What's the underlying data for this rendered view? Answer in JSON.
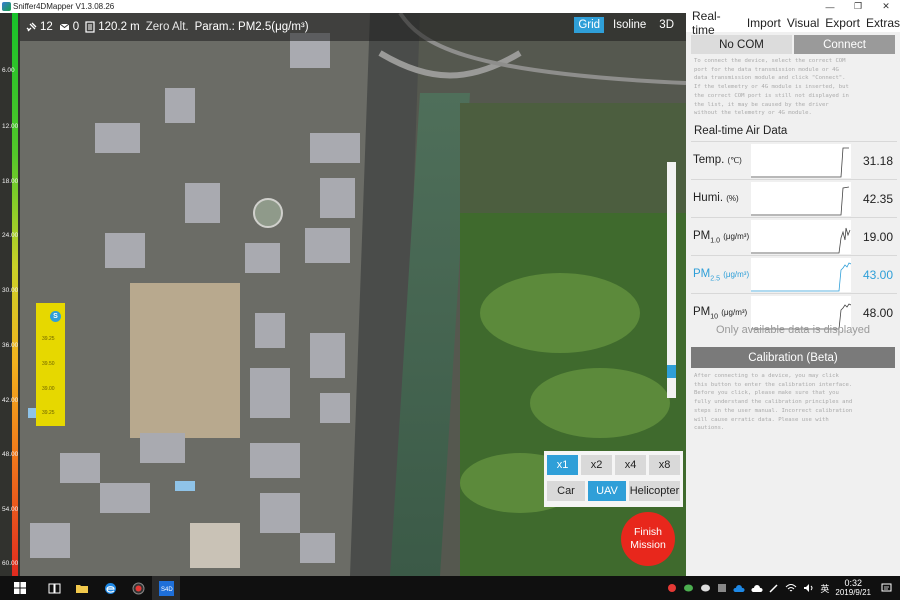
{
  "window": {
    "title": "Sniffer4DMapper V1.3.08.26"
  },
  "infobar": {
    "satellites": "12",
    "messages": "0",
    "altitude": "120.2 m",
    "zero_alt": "Zero Alt.",
    "param": "Param.: PM2.5(μg/m³)",
    "toggles": [
      "Grid",
      "Isoline",
      "3D"
    ],
    "active_toggle": "Grid"
  },
  "scale": {
    "ticks": [
      "6.00",
      "12.00",
      "18.00",
      "24.00",
      "30.00",
      "36.00",
      "42.00",
      "48.00",
      "54.00",
      "60.00"
    ]
  },
  "concentration_strip": {
    "values": [
      "39.25",
      "39.50",
      "39.00",
      "39.25"
    ]
  },
  "scroll": {
    "position_fraction": 0.91
  },
  "speed": {
    "options": [
      "x1",
      "x2",
      "x4",
      "x8"
    ],
    "active": "x1"
  },
  "vehicle": {
    "options": [
      "Car",
      "UAV",
      "Helicopter"
    ],
    "active": "UAV"
  },
  "finish": {
    "line1": "Finish",
    "line2": "Mission"
  },
  "panel": {
    "menu": [
      "Real-time",
      "Import",
      "Visual",
      "Export",
      "Extras"
    ],
    "no_com": "No COM",
    "connect": "Connect",
    "connect_hint": [
      "To connect the device, select the correct COM",
      "port for the data transmission module or 4G",
      "data transmission module and click \"Connect\".",
      "If the telemetry or 4G module is inserted, but",
      "the correct COM port is still not displayed in",
      "the list, it may be caused by the driver",
      "without the telemetry or 4G module."
    ],
    "air_data_title": "Real-time Air Data",
    "air_data": [
      {
        "label": "Temp.",
        "sub": "",
        "unit": "(℃)",
        "value": "31.18",
        "highlight": false
      },
      {
        "label": "Humi.",
        "sub": "",
        "unit": "(%)",
        "value": "42.35",
        "highlight": false
      },
      {
        "label": "PM",
        "sub": "1.0",
        "unit": "(μg/m³)",
        "value": "19.00",
        "highlight": false
      },
      {
        "label": "PM",
        "sub": "2.5",
        "unit": "(μg/m³)",
        "value": "43.00",
        "highlight": true
      },
      {
        "label": "PM",
        "sub": "10",
        "unit": "(μg/m³)",
        "value": "48.00",
        "highlight": false
      }
    ],
    "only_note": "Only available data is displayed",
    "calibration": "Calibration (Beta)",
    "calibration_hint": [
      "After connecting to a device, you may click",
      "this button to enter the calibration interface.",
      "Before you click, please make sure that you",
      "fully understand the calibration principles and",
      "steps in the user manual. Incorrect calibration",
      "will cause erratic data. Please use with",
      "cautions."
    ]
  },
  "taskbar": {
    "ime": "英",
    "time": "0:32",
    "date": "2019/9/21"
  },
  "colors": {
    "accent": "#2f9fd8",
    "finish": "#e8271c",
    "strip": "#e6d800"
  }
}
